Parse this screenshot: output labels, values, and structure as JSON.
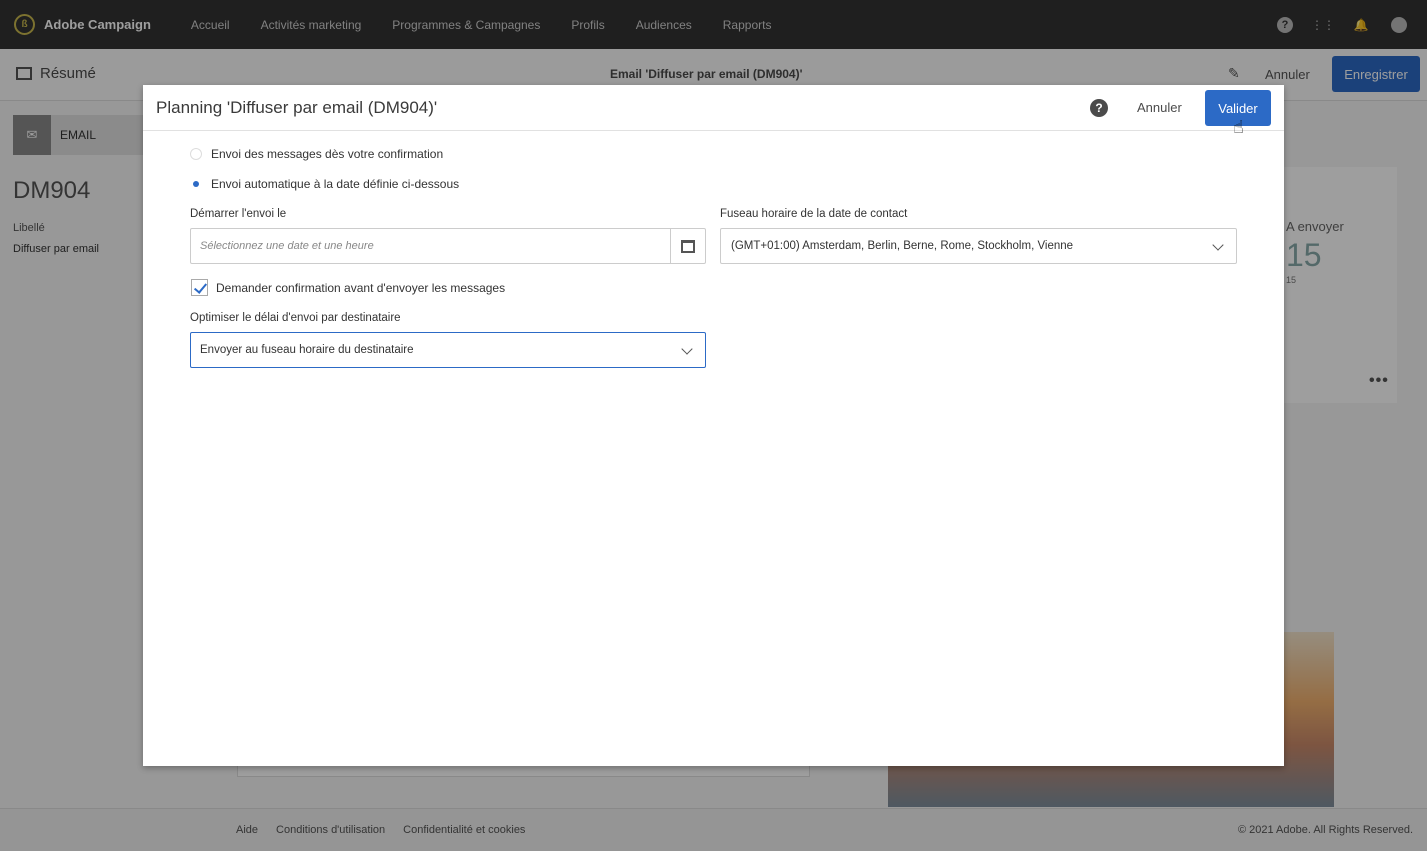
{
  "app": {
    "name": "Adobe Campaign"
  },
  "nav": {
    "items": [
      "Accueil",
      "Activités marketing",
      "Programmes & Campagnes",
      "Profils",
      "Audiences",
      "Rapports"
    ]
  },
  "header": {
    "resume": "Résumé",
    "title": "Email 'Diffuser par email (DM904)'",
    "cancel": "Annuler",
    "save": "Enregistrer"
  },
  "sidebar": {
    "tab": "EMAIL",
    "code": "DM904",
    "label_title": "Libellé",
    "label_value": "Diffuser par email"
  },
  "right_card": {
    "title": "A envoyer",
    "count": "15",
    "sub": "15"
  },
  "footer": {
    "links": [
      "Aide",
      "Conditions d'utilisation",
      "Confidentialité et cookies"
    ],
    "copyright": "© 2021 Adobe. All Rights Reserved."
  },
  "modal": {
    "title": "Planning 'Diffuser par email (DM904)'",
    "cancel": "Annuler",
    "validate": "Valider",
    "radio_immediate": "Envoi des messages dès votre confirmation",
    "radio_scheduled": "Envoi automatique à la date définie ci-dessous",
    "start_label": "Démarrer l'envoi le",
    "start_placeholder": "Sélectionnez une date et une heure",
    "tz_label": "Fuseau horaire de la date de contact",
    "tz_value": "(GMT+01:00) Amsterdam, Berlin, Berne, Rome, Stockholm, Vienne",
    "confirm_label": "Demander confirmation avant d'envoyer les messages",
    "optimize_label": "Optimiser le délai d'envoi par destinataire",
    "optimize_value": "Envoyer au fuseau horaire du destinataire"
  },
  "colors": {
    "accent": "#2c6ac6",
    "topbar": "#323232"
  }
}
